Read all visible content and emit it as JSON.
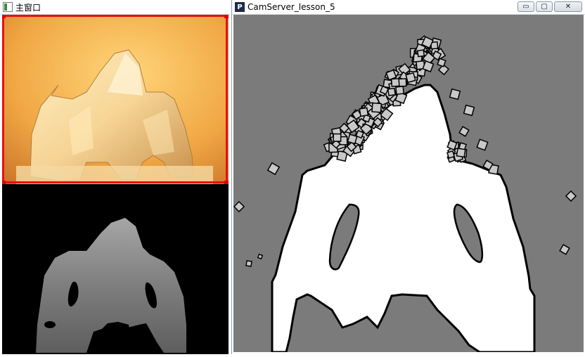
{
  "windows": {
    "main": {
      "title": "主窗口",
      "icon": "window-icon"
    },
    "camserver": {
      "title": "CamServer_lesson_5",
      "icon": "processing-p-icon",
      "controls": {
        "minimize": "▭",
        "maximize": "▢",
        "close": "✕"
      }
    }
  },
  "colors": {
    "camera_frame": "#e81010",
    "canvas_bg": "#7b7b7b",
    "silhouette": "#ffffff",
    "particle_fill": "#c8c8c8",
    "depth_bg": "#000000"
  }
}
